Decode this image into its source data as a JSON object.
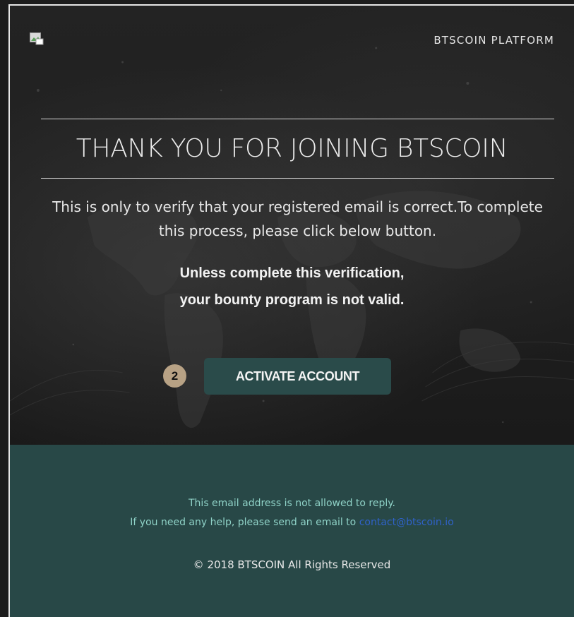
{
  "header": {
    "logo_icon": "broken-image-icon",
    "platform_label": "BTSCOIN PLATFORM"
  },
  "hero": {
    "title": "THANK YOU FOR JOINING BTSCOIN",
    "intro": "This is only to verify that your registered email is correct.To complete this process, please click below button.",
    "warning_line1": "Unless complete this verification,",
    "warning_line2": "your bounty program is not valid."
  },
  "cta": {
    "badge": "2",
    "label": "ACTIVATE ACCOUNT",
    "color": "#2a4b4a"
  },
  "footer": {
    "no_reply_notice": "This email address is not allowed to reply.",
    "help_prefix": "If you need any help, please send an email to",
    "help_email": "contact@btscoin.io",
    "copyright": "© 2018 BTSCOIN All Rights Reserved",
    "background": "#284847"
  }
}
